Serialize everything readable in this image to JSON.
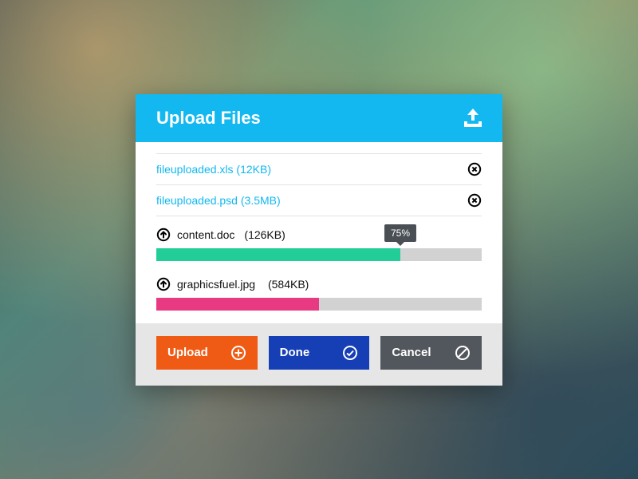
{
  "header": {
    "title": "Upload Files"
  },
  "uploaded": [
    {
      "name": "fileuploaded.xls",
      "size": "12KB"
    },
    {
      "name": "fileuploaded.psd",
      "size": "3.5MB"
    }
  ],
  "in_progress": [
    {
      "name": "content.doc",
      "size": "126KB",
      "percent": 75,
      "color": "green",
      "show_badge": true
    },
    {
      "name": "graphicsfuel.jpg",
      "size": "584KB",
      "percent": 50,
      "color": "pink",
      "show_badge": false
    }
  ],
  "footer": {
    "upload_label": "Upload",
    "done_label": "Done",
    "cancel_label": "Cancel"
  }
}
